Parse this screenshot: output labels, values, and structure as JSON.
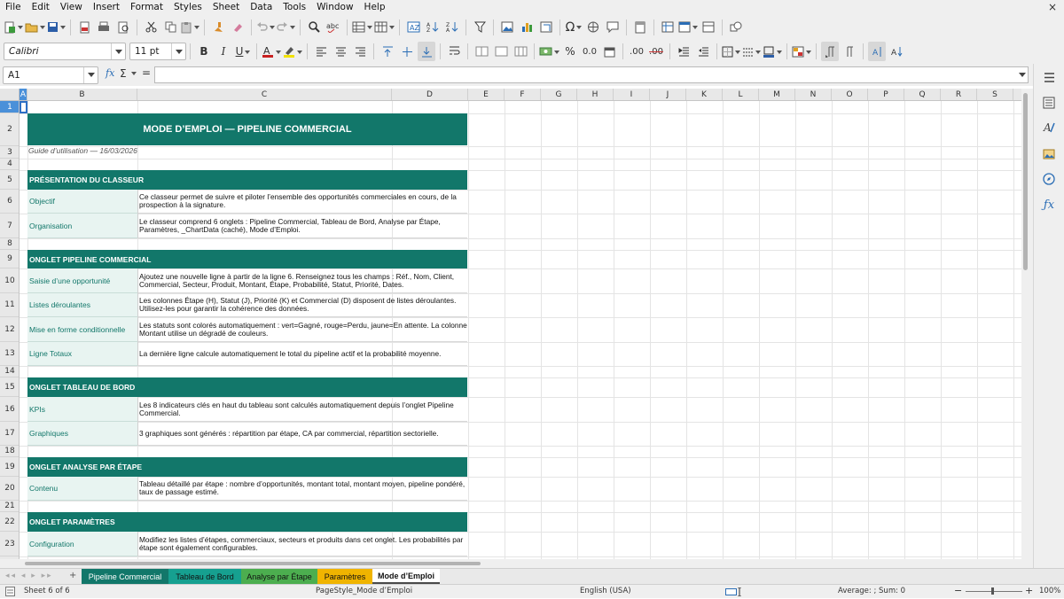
{
  "menu": [
    "File",
    "Edit",
    "View",
    "Insert",
    "Format",
    "Styles",
    "Sheet",
    "Data",
    "Tools",
    "Window",
    "Help"
  ],
  "close_glyph": "×",
  "toolbar2": {
    "font_name": "Calibri",
    "font_size": "11 pt",
    "bold": "B",
    "italic": "I",
    "underline": "U",
    "percent": "%",
    "decimal": "0.0",
    "add_decimal": ".00",
    "del_decimal": ".00"
  },
  "formula": {
    "cell_ref": "A1",
    "fx": "fx",
    "sum": "Σ",
    "equals": "=",
    "value": ""
  },
  "columns": [
    "A",
    "B",
    "C",
    "D",
    "E",
    "F",
    "G",
    "H",
    "I",
    "J",
    "K",
    "L",
    "M",
    "N",
    "O",
    "P",
    "Q",
    "R",
    "S"
  ],
  "rows": [
    "1",
    "2",
    "3",
    "4",
    "5",
    "6",
    "7",
    "8",
    "9",
    "10",
    "11",
    "12",
    "13",
    "14",
    "15",
    "16",
    "17",
    "18",
    "19",
    "20",
    "21",
    "22",
    "23"
  ],
  "doc": {
    "title": "MODE D’EMPLOI — PIPELINE COMMERCIAL",
    "subtitle": "Guide d’utilisation — 16/03/2026",
    "sections": [
      {
        "title": "PRÉSENTATION DU CLASSEUR",
        "rows": [
          {
            "label": "Objectif",
            "text": "Ce classeur permet de suivre et piloter l’ensemble des opportunités commerciales en cours, de la prospection à la signature."
          },
          {
            "label": "Organisation",
            "text": "Le classeur comprend 6 onglets : Pipeline Commercial, Tableau de Bord, Analyse par Étape, Paramètres, _ChartData (caché), Mode d’Emploi."
          }
        ]
      },
      {
        "title": "ONGLET PIPELINE COMMERCIAL",
        "rows": [
          {
            "label": "Saisie d’une opportunité",
            "text": "Ajoutez une nouvelle ligne à partir de la ligne 6. Renseignez tous les champs : Réf., Nom, Client, Commercial, Secteur, Produit, Montant, Étape, Probabilité, Statut, Priorité, Dates."
          },
          {
            "label": "Listes déroulantes",
            "text": "Les colonnes Étape (H), Statut (J), Priorité (K) et Commercial (D) disposent de listes déroulantes. Utilisez-les pour garantir la cohérence des données."
          },
          {
            "label": "Mise en forme conditionnelle",
            "text": "Les statuts sont colorés automatiquement : vert=Gagné, rouge=Perdu, jaune=En attente. La colonne Montant utilise un dégradé de couleurs."
          },
          {
            "label": "Ligne Totaux",
            "text": "La dernière ligne calcule automatiquement le total du pipeline actif et la probabilité moyenne."
          }
        ]
      },
      {
        "title": "ONGLET TABLEAU DE BORD",
        "rows": [
          {
            "label": "KPIs",
            "text": "Les 8 indicateurs clés en haut du tableau sont calculés automatiquement depuis l’onglet Pipeline Commercial."
          },
          {
            "label": "Graphiques",
            "text": "3 graphiques sont générés : répartition par étape, CA par commercial, répartition sectorielle."
          }
        ]
      },
      {
        "title": "ONGLET ANALYSE PAR ÉTAPE",
        "rows": [
          {
            "label": "Contenu",
            "text": "Tableau détaillé par étape : nombre d’opportunités, montant total, montant moyen, pipeline pondéré, taux de passage estimé."
          }
        ]
      },
      {
        "title": "ONGLET PARAMÈTRES",
        "rows": [
          {
            "label": "Configuration",
            "text": "Modifiez les listes d’étapes, commerciaux, secteurs et produits dans cet onglet. Les probabilités par étape sont également configurables."
          }
        ]
      }
    ]
  },
  "tabs": [
    {
      "label": "Pipeline Commercial",
      "color": "#12776a",
      "text_color": "#ffffff"
    },
    {
      "label": "Tableau de Bord",
      "color": "#16a090",
      "text_color": "#111111"
    },
    {
      "label": "Analyse par Étape",
      "color": "#4cae4f",
      "text_color": "#111111"
    },
    {
      "label": "Paramètres",
      "color": "#f0b400",
      "text_color": "#111111"
    },
    {
      "label": "Mode d’Emploi",
      "color": "#ffffff",
      "text_color": "#111111"
    }
  ],
  "tab_nav": "◂◂ ◂ ▸ ▸▸",
  "add_tab": "+",
  "status": {
    "sheet": "Sheet 6 of 6",
    "page_style": "PageStyle_Mode d’Emploi",
    "language": "English (USA)",
    "summary": "Average: ; Sum: 0",
    "zoom": "100%"
  },
  "colors": {
    "accent": "#12776a",
    "label_bg": "#e8f4f1",
    "selection": "#4a90d9"
  },
  "icons": [
    "new-icon",
    "open-icon",
    "save-icon",
    "pdf-icon",
    "print-icon",
    "preview-icon",
    "cut-icon",
    "copy-icon",
    "paste-icon",
    "clone-icon",
    "clear-icon",
    "undo-icon",
    "redo-icon",
    "find-icon",
    "spellcheck-icon",
    "row-icon",
    "column-icon",
    "sort-icon",
    "sort-asc-icon",
    "sort-desc-icon",
    "autofilter-icon",
    "image-icon",
    "chart-icon",
    "pivot-icon",
    "special-char-icon",
    "hyperlink-icon",
    "comment-icon",
    "header-icon",
    "define-print-icon",
    "freeze-icon",
    "split-icon",
    "show-draw-icon"
  ]
}
